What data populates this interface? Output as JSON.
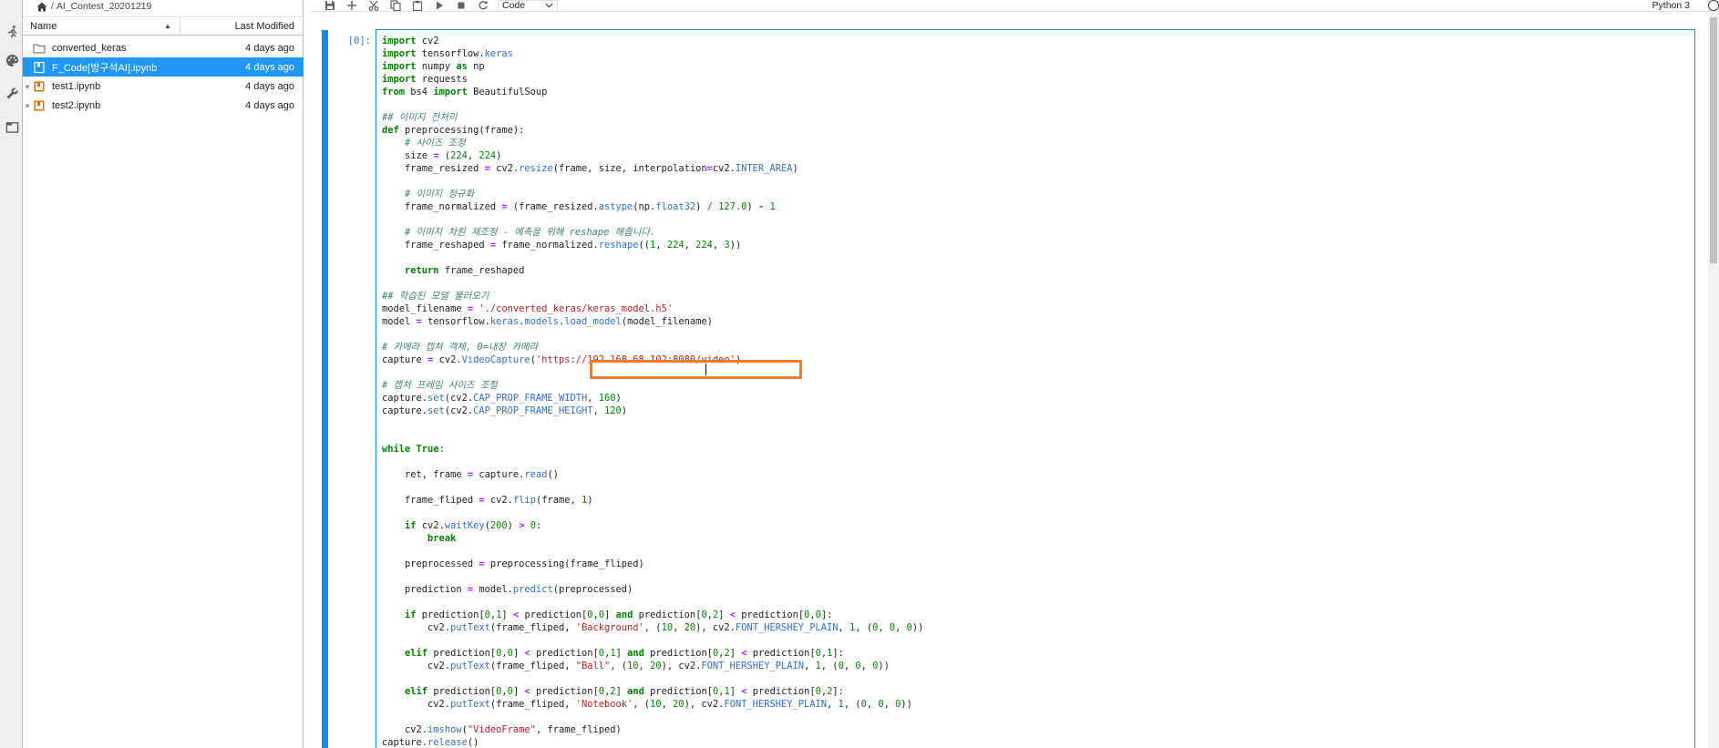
{
  "activity_bar": {
    "icons": [
      "running-icon",
      "palette-icon",
      "wrench-icon",
      "tabs-icon"
    ]
  },
  "file_browser": {
    "breadcrumb": "AI_Contest_20201219",
    "columns": {
      "name": "Name",
      "modified": "Last Modified"
    },
    "items": [
      {
        "name": "converted_keras",
        "modified": "4 days ago",
        "type": "folder",
        "selected": false,
        "running": false
      },
      {
        "name": "F_Code[방구석AI].ipynb",
        "modified": "4 days ago",
        "type": "notebook",
        "selected": true,
        "running": false
      },
      {
        "name": "test1.ipynb",
        "modified": "4 days ago",
        "type": "notebook",
        "selected": false,
        "running": true
      },
      {
        "name": "test2.ipynb",
        "modified": "4 days ago",
        "type": "notebook",
        "selected": false,
        "running": true
      }
    ]
  },
  "toolbar": {
    "cell_type": "Code",
    "kernel": "Python 3",
    "buttons": [
      "save-icon",
      "add-cell-icon",
      "cut-icon",
      "copy-icon",
      "paste-icon",
      "run-icon",
      "stop-icon",
      "restart-icon"
    ]
  },
  "cell": {
    "prompt": "[0]:",
    "lines": [
      "import cv2",
      "import tensorflow.keras",
      "import numpy as np",
      "import requests",
      "from bs4 import BeautifulSoup",
      "",
      "## 이미지 전처리",
      "def preprocessing(frame):",
      "    # 사이즈 조정",
      "    size = (224, 224)",
      "    frame_resized = cv2.resize(frame, size, interpolation=cv2.INTER_AREA)",
      "",
      "    # 이미지 정규화",
      "    frame_normalized = (frame_resized.astype(np.float32) / 127.0) - 1",
      "",
      "    # 이미지 차원 재조정 - 예측을 위해 reshape 해줍니다.",
      "    frame_reshaped = frame_normalized.reshape((1, 224, 224, 3))",
      "",
      "    return frame_reshaped",
      "",
      "## 학습된 모델 불러오기",
      "model_filename = './converted_keras/keras_model.h5'",
      "model = tensorflow.keras.models.load_model(model_filename)",
      "",
      "# 카메라 캡쳐 객체, 0=내장 카메라",
      "capture = cv2.VideoCapture('https://192.168.68.102:8080/video')",
      "",
      "# 캡쳐 프레임 사이즈 조절",
      "capture.set(cv2.CAP_PROP_FRAME_WIDTH, 160)",
      "capture.set(cv2.CAP_PROP_FRAME_HEIGHT, 120)",
      "",
      "",
      "while True:",
      "",
      "    ret, frame = capture.read()",
      "",
      "    frame_fliped = cv2.flip(frame, 1)",
      "",
      "    if cv2.waitKey(200) > 0:",
      "        break",
      "",
      "    preprocessed = preprocessing(frame_fliped)",
      "",
      "    prediction = model.predict(preprocessed)",
      "",
      "    if prediction[0,1] < prediction[0,0] and prediction[0,2] < prediction[0,0]:",
      "        cv2.putText(frame_fliped, 'Background', (10, 20), cv2.FONT_HERSHEY_PLAIN, 1, (0, 0, 0))",
      "",
      "    elif prediction[0,0] < prediction[0,1] and prediction[0,2] < prediction[0,1]:",
      "        cv2.putText(frame_fliped, \"Ball\", (10, 20), cv2.FONT_HERSHEY_PLAIN, 1, (0, 0, 0))",
      "",
      "    elif prediction[0,0] < prediction[0,2] and prediction[0,1] < prediction[0,2]:",
      "        cv2.putText(frame_fliped, 'Notebook', (10, 20), cv2.FONT_HERSHEY_PLAIN, 1, (0, 0, 0))",
      "",
      "    cv2.imshow(\"VideoFrame\", frame_fliped)",
      "capture.release()"
    ]
  },
  "colors": {
    "accent": "#2196f3",
    "highlight_box": "#f57c24",
    "cell_border": "#1e88e5"
  }
}
